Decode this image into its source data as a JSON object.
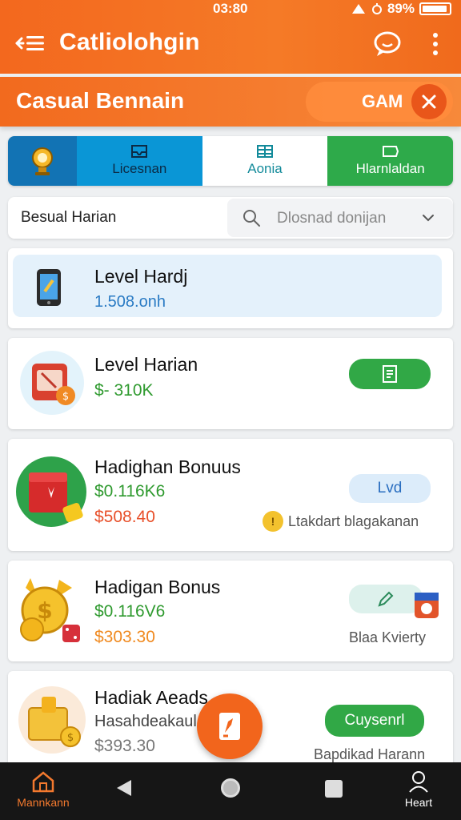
{
  "status_bar": {
    "time": "03:80",
    "battery": "89%"
  },
  "app_bar": {
    "title": "Catliolohgin"
  },
  "banner": {
    "title": "Casual Bennain",
    "pill_label": "GAM"
  },
  "tabs": [
    {
      "label": "Licesnan",
      "icon": "inbox-icon"
    },
    {
      "label": "Aonia",
      "icon": "grid-icon"
    },
    {
      "label": "Hlarnlaldan",
      "icon": "ticket-icon"
    }
  ],
  "search": {
    "label": "Besual Harian",
    "placeholder": "Dlosnad donijan"
  },
  "cards": [
    {
      "title": "Level Hardj",
      "line1": "1.508.onh",
      "icon": "phone-icon"
    },
    {
      "title": "Level Harian",
      "line1": "$- 310K",
      "icon": "slot-machine-icon"
    },
    {
      "title": "Hadighan Bonuus",
      "line1": "$0.116K6",
      "line2": "$508.40",
      "button": "Lvd",
      "caption": "Ltakdart blagakanan",
      "icon": "gift-box-icon"
    },
    {
      "title": "Hadigan Bonus",
      "line1": "$0.116V6",
      "line2": "$303.30",
      "caption": "Blaa Kvierty",
      "icon": "coins-icon"
    },
    {
      "title": "Hadiak Aeads",
      "line1": "Hasahdeakaulcn",
      "line2": "$393.30",
      "button": "Cuysenrl",
      "caption": "Bapdikad Harann",
      "icon": "treasure-icon"
    }
  ],
  "bottom_nav": {
    "home_label": "Mannkann",
    "profile_label": "Heart"
  },
  "colors": {
    "primary": "#f3681e",
    "green": "#31a846",
    "blue": "#0a96d6",
    "dark": "#161616"
  }
}
